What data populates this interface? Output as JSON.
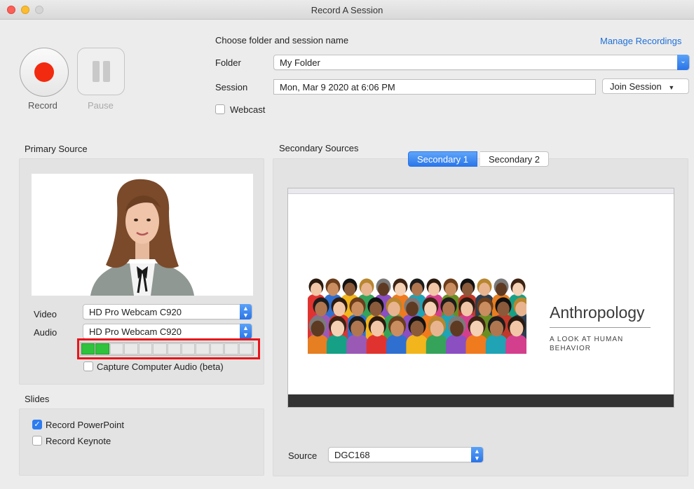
{
  "window": {
    "title": "Record A Session"
  },
  "controls": {
    "record_label": "Record",
    "pause_label": "Pause"
  },
  "session_setup": {
    "heading": "Choose folder and session name",
    "manage_link": "Manage Recordings",
    "folder_label": "Folder",
    "folder_value": "My Folder",
    "session_label": "Session",
    "session_value": "Mon, Mar 9 2020 at 6:06 PM",
    "join_button": "Join Session",
    "webcast_label": "Webcast",
    "webcast_checked": false
  },
  "primary": {
    "heading": "Primary Source",
    "video_label": "Video",
    "video_value": "HD Pro Webcam C920",
    "audio_label": "Audio",
    "audio_value": "HD Pro Webcam C920",
    "audio_level_active_cells": 2,
    "audio_level_total_cells": 12,
    "capture_audio_label": "Capture Computer Audio (beta)",
    "capture_audio_checked": false
  },
  "slides": {
    "heading": "Slides",
    "record_powerpoint_label": "Record PowerPoint",
    "record_powerpoint_checked": true,
    "record_keynote_label": "Record Keynote",
    "record_keynote_checked": false
  },
  "secondary": {
    "heading": "Secondary Sources",
    "tabs": [
      "Secondary 1",
      "Secondary 2"
    ],
    "active_tab": 0,
    "slide_title": "Anthropology",
    "slide_subtitle_line1": "A LOOK AT HUMAN",
    "slide_subtitle_line2": "BEHAVIOR",
    "source_label": "Source",
    "source_value": "DGC168"
  },
  "colors": {
    "accent": "#2e7bf0",
    "record": "#f22a0f",
    "meter_on": "#2fc33d",
    "highlight": "#e8151b"
  }
}
